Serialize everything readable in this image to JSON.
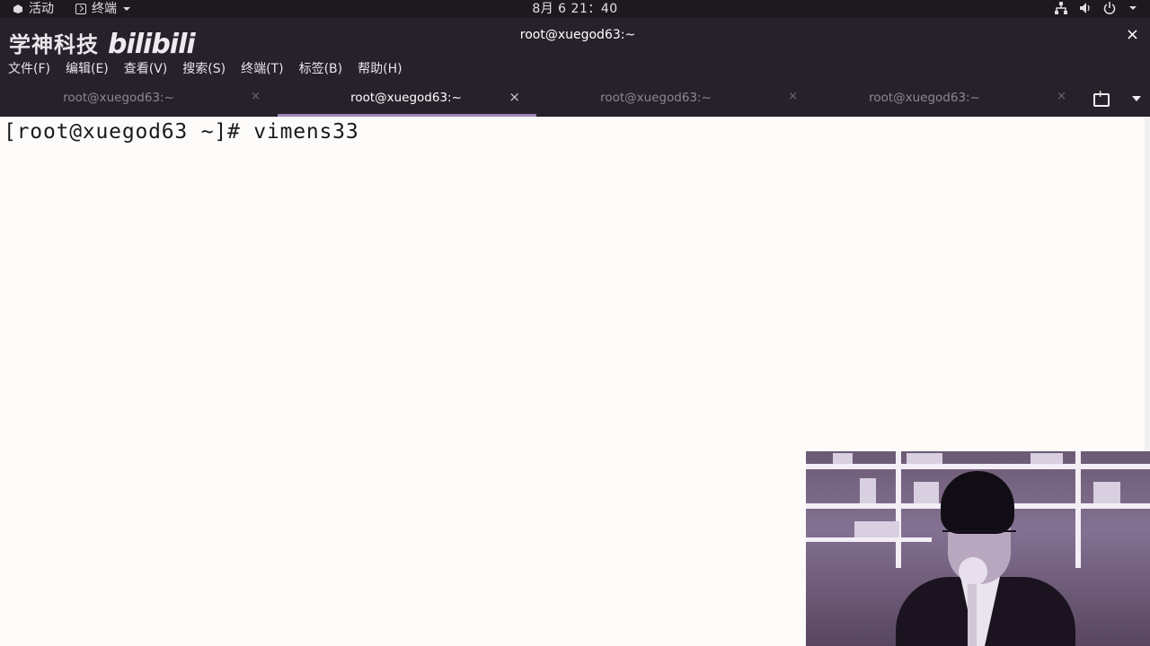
{
  "topbar": {
    "activities": "活动",
    "app_menu": "终端",
    "clock": "8月 6  21：40",
    "status_icons": [
      "network-icon",
      "volume-icon",
      "power-icon",
      "chevron-down-icon"
    ]
  },
  "watermark": {
    "text": "学神科技",
    "brand": "bilibili"
  },
  "window": {
    "title": "root@xuegod63:~",
    "close": "×"
  },
  "menu": {
    "items": [
      "文件(F)",
      "编辑(E)",
      "查看(V)",
      "搜索(S)",
      "终端(T)",
      "标签(B)",
      "帮助(H)"
    ]
  },
  "tabs": [
    {
      "label": "root@xuegod63:~",
      "close": "×",
      "active": false
    },
    {
      "label": "root@xuegod63:~",
      "close": "×",
      "active": true
    },
    {
      "label": "root@xuegod63:~",
      "close": "×",
      "active": false
    },
    {
      "label": "root@xuegod63:~",
      "close": "×",
      "active": false
    }
  ],
  "terminal": {
    "lines": [
      "[root@xuegod63 ~]# vimens33"
    ]
  },
  "colors": {
    "topbar_bg": "#1d191f",
    "chrome_bg": "#27212b",
    "terminal_bg": "#fcfbfa",
    "terminal_fg": "#1a1a1a",
    "active_tab_accent": "#9b86b3"
  }
}
